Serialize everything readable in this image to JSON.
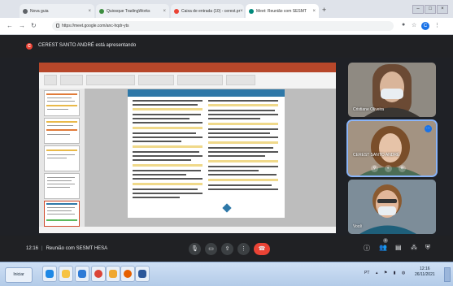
{
  "browser": {
    "tabs": [
      {
        "label": "Nova guia",
        "icon": "browser-tab-icon",
        "color": "#5f6368"
      },
      {
        "label": "Quiosque TradingWorks",
        "icon": "globe-icon",
        "color": "#3c8d3f"
      },
      {
        "label": "Caixa de entrada (10) - cerest.pr",
        "icon": "gmail-icon",
        "color": "#ea4335"
      },
      {
        "label": "Meet: Reunião com SESMT",
        "icon": "meet-icon",
        "color": "#00897b"
      }
    ],
    "new_tab": "+",
    "close": "×",
    "url": "https://meet.google.com/anc-hqdr-yts",
    "avatar_letter": "C"
  },
  "presenting": {
    "badge": "C",
    "text": "CEREST SANTO ANDRÉ está apresentando"
  },
  "participants": [
    {
      "name": "Cristiane Oliveira",
      "bg": "#8f8a82",
      "skin": "#d9b59a",
      "hair": "#6b4a34"
    },
    {
      "name": "CEREST SANTO ANDRÉ",
      "bg": "#9a8a78",
      "skin": "#e6c3a8",
      "hair": "#7a4e2a"
    },
    {
      "name": "Você",
      "bg": "#6e7f8e",
      "skin": "#e2b79a",
      "hair": "#8a5a30"
    }
  ],
  "meeting": {
    "time": "12:16",
    "separator": "|",
    "title": "Reunião com SESMT HESA",
    "participant_count": "3"
  },
  "taskbar": {
    "start_label": "Iniciar",
    "icons": [
      {
        "name": "ie-icon",
        "color": "#1e88e5"
      },
      {
        "name": "explorer-icon",
        "color": "#f6c343"
      },
      {
        "name": "media-icon",
        "color": "#2e7bd6"
      },
      {
        "name": "chrome-icon",
        "color": "#db4437"
      },
      {
        "name": "files-icon",
        "color": "#f0a830"
      },
      {
        "name": "firefox-icon",
        "color": "#e66000"
      },
      {
        "name": "word-icon",
        "color": "#2b579a"
      }
    ],
    "tray": "PT",
    "clock_time": "12:16",
    "clock_date": "26/11/2021"
  },
  "colors": {
    "meet_dark": "#202124",
    "end_call": "#ea4335",
    "accent": "#1a73e8",
    "ppt_red": "#b7472a"
  }
}
